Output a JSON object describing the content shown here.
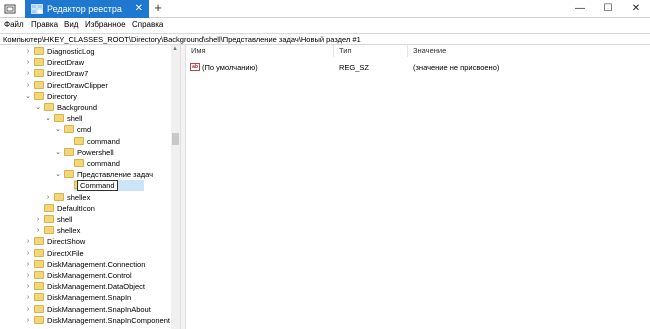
{
  "window": {
    "tab_title": "Редактор реестра",
    "tab_close": "✕",
    "new_tab": "+",
    "minimize": "—",
    "maximize": "☐",
    "close": "✕"
  },
  "menu": [
    "Файл",
    "Правка",
    "Вид",
    "Избранное",
    "Справка"
  ],
  "address": "Компьютер\\HKEY_CLASSES_ROOT\\Directory\\Background\\shell\\Представление задач\\Новый раздел #1",
  "tree": [
    {
      "label": "DiagnosticLog",
      "expander": "›"
    },
    {
      "label": "DirectDraw",
      "expander": "›"
    },
    {
      "label": "DirectDraw7",
      "expander": "›"
    },
    {
      "label": "DirectDrawClipper",
      "expander": "›"
    },
    {
      "label": "Directory",
      "expander": "⌄"
    },
    {
      "label": "Background",
      "expander": "⌄"
    },
    {
      "label": "shell",
      "expander": "⌄"
    },
    {
      "label": "cmd",
      "expander": "⌄"
    },
    {
      "label": "command",
      "expander": ""
    },
    {
      "label": "Powershell",
      "expander": "⌄"
    },
    {
      "label": "command",
      "expander": ""
    },
    {
      "label": "Представление задач",
      "expander": "⌄"
    },
    {
      "label": "Command",
      "expander": ""
    },
    {
      "label": "shellex",
      "expander": "›"
    },
    {
      "label": "DefaultIcon",
      "expander": ""
    },
    {
      "label": "shell",
      "expander": "›"
    },
    {
      "label": "shellex",
      "expander": "›"
    },
    {
      "label": "DirectShow",
      "expander": "›"
    },
    {
      "label": "DirectXFile",
      "expander": "›"
    },
    {
      "label": "DiskManagement.Connection",
      "expander": "›"
    },
    {
      "label": "DiskManagement.Control",
      "expander": "›"
    },
    {
      "label": "DiskManagement.DataObject",
      "expander": "›"
    },
    {
      "label": "DiskManagement.SnapIn",
      "expander": "›"
    },
    {
      "label": "DiskManagement.SnapInAbout",
      "expander": "›"
    },
    {
      "label": "DiskManagement.SnapInComponent",
      "expander": "›"
    }
  ],
  "list": {
    "columns": [
      "Имя",
      "Тип",
      "Значение"
    ],
    "rows": [
      {
        "icon": "ab",
        "name": "(По умолчанию)",
        "type": "REG_SZ",
        "value": "(значение не присвоено)"
      }
    ]
  },
  "colors": {
    "accent": "#1e78d0",
    "folder": "#f4d67a",
    "edit_highlight": "#cce4f7"
  }
}
